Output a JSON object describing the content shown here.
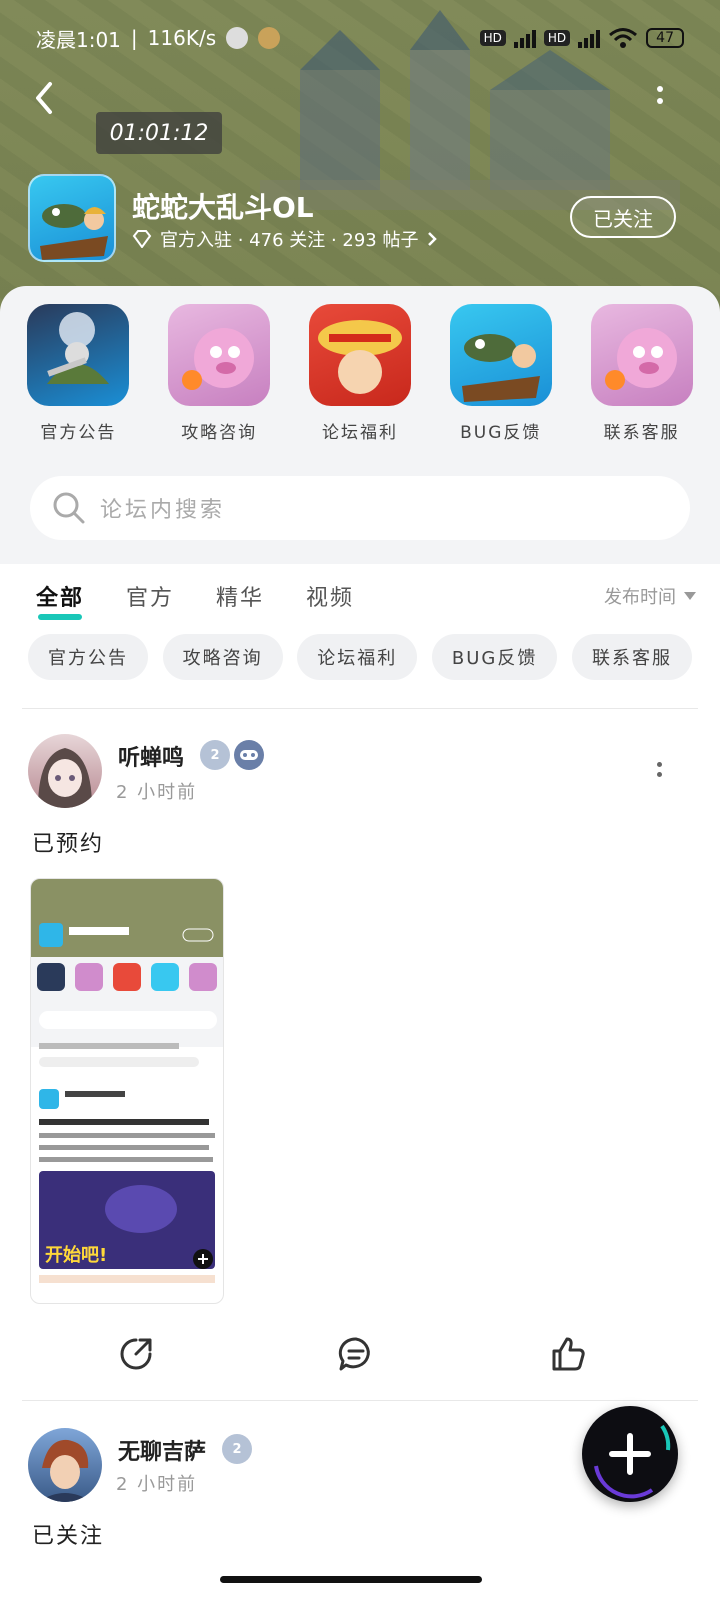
{
  "status_bar": {
    "time": "凌晨1:01",
    "speed": "116K/s",
    "battery": "47"
  },
  "timer": "01:01:12",
  "game": {
    "title": "蛇蛇大乱斗OL",
    "meta": "官方入驻 · 476 关注 · 293 帖子",
    "follow_label": "已关注"
  },
  "shortcuts": [
    {
      "label": "官方公告"
    },
    {
      "label": "攻略咨询"
    },
    {
      "label": "论坛福利"
    },
    {
      "label": "BUG反馈"
    },
    {
      "label": "联系客服"
    }
  ],
  "search": {
    "placeholder": "论坛内搜索"
  },
  "tabs": [
    {
      "label": "全部"
    },
    {
      "label": "官方"
    },
    {
      "label": "精华"
    },
    {
      "label": "视频"
    }
  ],
  "sort_label": "发布时间",
  "chips": [
    {
      "label": "官方公告"
    },
    {
      "label": "攻略咨询"
    },
    {
      "label": "论坛福利"
    },
    {
      "label": "BUG反馈"
    },
    {
      "label": "联系客服"
    }
  ],
  "posts": [
    {
      "user": "听蝉鸣",
      "level": "2",
      "time": "2 小时前",
      "text": "已预约"
    },
    {
      "user": "无聊吉萨",
      "level": "2",
      "time": "2 小时前",
      "text": "已关注"
    }
  ],
  "colors": {
    "accent": "#19c7b8",
    "panel": "#f3f4f6",
    "fab": "#0d0d12"
  }
}
